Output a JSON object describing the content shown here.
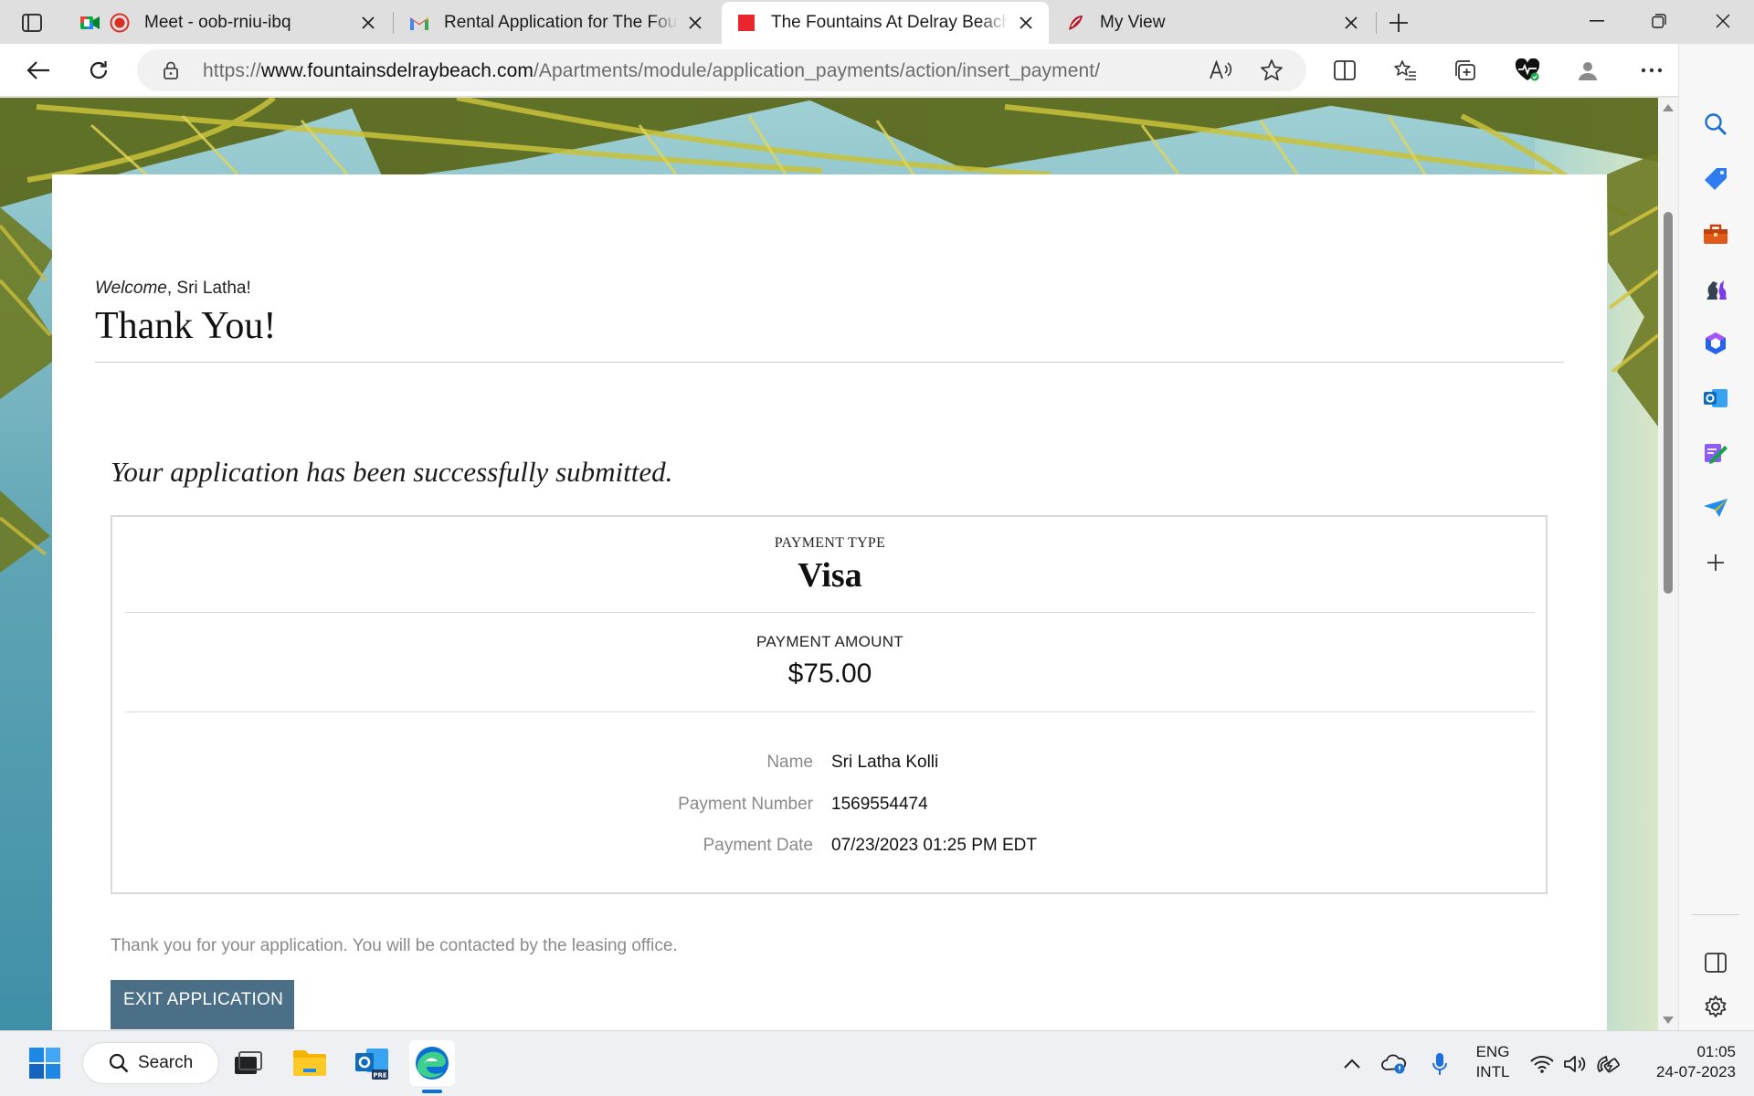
{
  "browser": {
    "tabs": [
      {
        "title": "Meet - oob-rniu-ibq",
        "icon": "google-meet-icon"
      },
      {
        "title": "Rental Application for The Fountains At Delray Beach",
        "icon": "gmail-icon"
      },
      {
        "title": "The Fountains At Delray Beach | Rental Application",
        "icon": "site-favicon-icon"
      },
      {
        "title": "My View",
        "icon": "my-view-icon"
      }
    ],
    "url": {
      "scheme": "https://",
      "host": "www.fountainsdelraybeach.com",
      "path": "/Apartments/module/application_payments/action/insert_payment/"
    }
  },
  "page": {
    "welcome_prefix": "Welcome",
    "welcome_name": ", Sri Latha!",
    "title": "Thank You!",
    "success_message": "Your application has been successfully submitted.",
    "payment": {
      "type_label": "PAYMENT TYPE",
      "type_value": "Visa",
      "amount_label": "PAYMENT AMOUNT",
      "amount_value": "$75.00",
      "details": [
        {
          "key": "Name",
          "value": "Sri Latha Kolli"
        },
        {
          "key": "Payment Number",
          "value": "1569554474"
        },
        {
          "key": "Payment Date",
          "value": "07/23/2023 01:25 PM EDT"
        }
      ]
    },
    "thanks_note": "Thank you for your application. You will be contacted by the leasing office.",
    "exit_button": "EXIT APPLICATION"
  },
  "taskbar": {
    "search_label": "Search",
    "language_top": "ENG",
    "language_bottom": "INTL",
    "time": "01:05",
    "date": "24-07-2023"
  },
  "colors": {
    "accent_button": "#4a6f86",
    "edge_blue": "#0a6fd6",
    "recording_red": "#d93025"
  }
}
